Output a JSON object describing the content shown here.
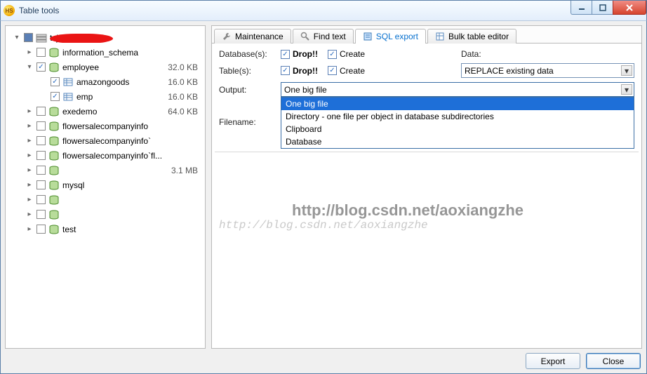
{
  "window": {
    "title": "Table tools"
  },
  "tree": [
    {
      "level": 1,
      "expand": "▾",
      "chk": "filled",
      "icon": "server",
      "label": "tsj*_",
      "size": "",
      "redact": true
    },
    {
      "level": 2,
      "expand": "▸",
      "chk": "",
      "icon": "db",
      "label": "information_schema",
      "size": ""
    },
    {
      "level": 2,
      "expand": "▾",
      "chk": "✓",
      "icon": "db",
      "label": "employee",
      "size": "32.0 KB"
    },
    {
      "level": 3,
      "expand": "",
      "chk": "✓",
      "icon": "table",
      "label": "amazongoods",
      "size": "16.0 KB"
    },
    {
      "level": 3,
      "expand": "",
      "chk": "✓",
      "icon": "table",
      "label": "emp",
      "size": "16.0 KB"
    },
    {
      "level": 2,
      "expand": "▸",
      "chk": "",
      "icon": "db",
      "label": "exedemo",
      "size": "64.0 KB"
    },
    {
      "level": 2,
      "expand": "▸",
      "chk": "",
      "icon": "db",
      "label": "flowersalecompanyinfo",
      "size": ""
    },
    {
      "level": 2,
      "expand": "▸",
      "chk": "",
      "icon": "db",
      "label": "flowersalecompanyinfo`",
      "size": ""
    },
    {
      "level": 2,
      "expand": "▸",
      "chk": "",
      "icon": "db",
      "label": "flowersalecompanyinfo`fl...",
      "size": ""
    },
    {
      "level": 2,
      "expand": "▸",
      "chk": "",
      "icon": "db",
      "label": "",
      "size": "3.1 MB",
      "redact": true
    },
    {
      "level": 2,
      "expand": "▸",
      "chk": "",
      "icon": "db",
      "label": "mysql",
      "size": ""
    },
    {
      "level": 2,
      "expand": "▸",
      "chk": "",
      "icon": "db",
      "label": "",
      "size": "",
      "redact": true
    },
    {
      "level": 2,
      "expand": "▸",
      "chk": "",
      "icon": "db",
      "label": "",
      "size": "",
      "redact": true
    },
    {
      "level": 2,
      "expand": "▸",
      "chk": "",
      "icon": "db",
      "label": "test",
      "size": ""
    }
  ],
  "tabs": [
    {
      "id": "maintenance",
      "label": "Maintenance"
    },
    {
      "id": "find-text",
      "label": "Find text"
    },
    {
      "id": "sql-export",
      "label": "SQL export",
      "active": true
    },
    {
      "id": "bulk-editor",
      "label": "Bulk table editor"
    }
  ],
  "form": {
    "databases_label": "Database(s):",
    "tables_label": "Table(s):",
    "output_label": "Output:",
    "filename_label": "Filename:",
    "data_label": "Data:",
    "drop_label": "Drop!!",
    "create_label": "Create",
    "data_combo": "REPLACE existing data",
    "output_combo": "One big file",
    "output_options": [
      "One big file",
      "Directory - one file per object in database subdirectories",
      "Clipboard",
      "Database"
    ]
  },
  "watermark": {
    "big": "http://blog.csdn.net/aoxiangzhe",
    "small": "http://blog.csdn.net/aoxiangzhe"
  },
  "footer": {
    "export": "Export",
    "close": "Close"
  }
}
